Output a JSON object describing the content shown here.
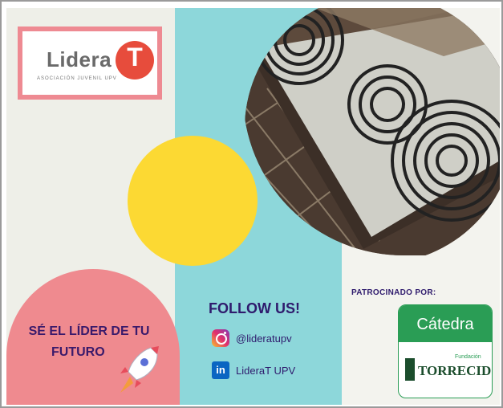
{
  "logo": {
    "name": "LideraT",
    "name_prefix": "Lidera",
    "name_suffix": "T",
    "subtitle": "ASOCIACIÓN JUVENIL UPV"
  },
  "slogan": {
    "line1": "SÉ EL LÍDER DE TU",
    "line2": "FUTURO"
  },
  "follow": {
    "title": "FOLLOW US!",
    "instagram": "@lideratupv",
    "linkedin": "LideraT UPV",
    "icons": [
      "instagram-icon",
      "linkedin-icon"
    ]
  },
  "sponsor": {
    "label": "PATROCINADO POR:",
    "catedra": "Cátedra",
    "fundacion": "Fundación",
    "company": "TORRECID"
  },
  "colors": {
    "pink": "#ef8a8f",
    "teal": "#8dd7da",
    "yellow": "#fcd933",
    "navy": "#2f1b6d",
    "green": "#2a9d55"
  }
}
